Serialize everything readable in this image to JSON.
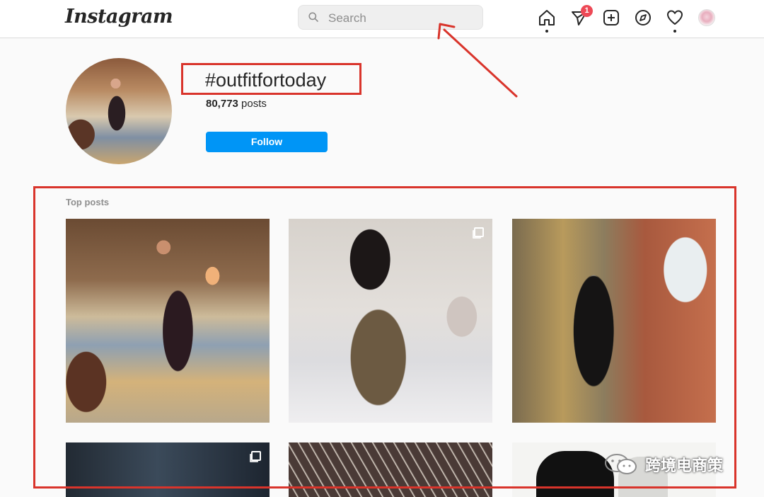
{
  "header": {
    "logo_text": "Instagram",
    "search_placeholder": "Search",
    "nav_icons": [
      "home-icon",
      "direct-icon",
      "new-post-icon",
      "explore-icon",
      "activity-icon",
      "profile-avatar"
    ],
    "direct_badge": "1"
  },
  "hashtag": {
    "name": "#outfitfortoday",
    "post_count": "80,773",
    "post_count_suffix": " posts",
    "follow_label": "Follow"
  },
  "top_posts": {
    "label": "Top posts",
    "tiles": [
      {
        "multi": false
      },
      {
        "multi": true
      },
      {
        "multi": false
      },
      {
        "multi": true
      },
      {
        "multi": false
      },
      {
        "multi": false
      }
    ]
  },
  "annotations": {
    "color": "#d9342b"
  },
  "watermark": {
    "text": "跨境电商策"
  },
  "colors": {
    "accent": "#0095f6",
    "badge": "#ed4956",
    "text": "#262626",
    "muted": "#8e8e8e"
  }
}
